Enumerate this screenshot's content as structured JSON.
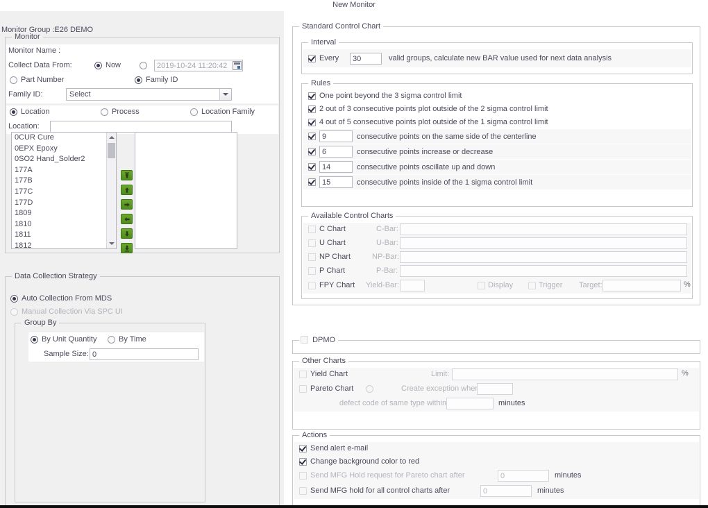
{
  "window": {
    "title": "New Monitor"
  },
  "left": {
    "monitor_group_label": "Monitor Group :E26 DEMO",
    "monitor_legend": "Monitor",
    "monitor_name_label": "Monitor Name :",
    "collect_data_from_label": "Collect Data From:",
    "now_label": "Now",
    "datetime_value": "2019-10-24 11:20:42",
    "calendar_icon": "calendar-icon",
    "part_number_label": "Part Number",
    "family_id_radio_label": "Family ID",
    "family_id_label": "Family ID:",
    "family_id_value": "Select",
    "location_radio_label": "Location",
    "process_radio_label": "Process",
    "location_family_radio_label": "Location Family",
    "location_label": "Location:",
    "location_value": "",
    "available_items": [
      "0CUR Cure",
      "0EPX Epoxy",
      "0SO2 Hand_Solder2",
      "177A",
      "177B",
      "177C",
      "177D",
      "1809",
      "1810",
      "1811",
      "1812"
    ],
    "selected_items": [],
    "transfer_buttons": [
      "move-all-up-button",
      "move-up-button",
      "move-right-button",
      "move-left-button",
      "move-down-button",
      "move-all-down-button"
    ],
    "strategy_legend": "Data Collection Strategy",
    "auto_collection_label": "Auto Collection From MDS",
    "manual_collection_label": "Manual Collection Via SPC UI",
    "group_by_legend": "Group By",
    "by_unit_quantity_label": "By Unit Quantity",
    "by_time_label": "By Time",
    "sample_size_label": "Sample Size:",
    "sample_size_value": "0"
  },
  "right": {
    "scc_legend": "Standard Control Chart",
    "interval": {
      "legend": "Interval",
      "every_label": "Every",
      "every_value": "30",
      "description": "valid groups, calculate new BAR value used for next data analysis"
    },
    "rules": {
      "legend": "Rules",
      "simple": [
        "One point beyond the 3 sigma control limit",
        "2 out of 3 consecutive points plot outside of the 2 sigma control limit",
        "4 out of 5 consecutive points plot outside of the 1 sigma control limit"
      ],
      "numeric": [
        {
          "value": "9",
          "text": "consecutive points on the same side of the centerline"
        },
        {
          "value": "6",
          "text": "consecutive points increase or decrease"
        },
        {
          "value": "14",
          "text": "consecutive points oscillate up and down"
        },
        {
          "value": "15",
          "text": "consecutive points inside of the 1 sigma control limit"
        }
      ]
    },
    "available_charts": {
      "legend": "Available Control Charts",
      "rows": [
        {
          "name": "C Chart",
          "bar_label": "C-Bar:",
          "value": ""
        },
        {
          "name": "U Chart",
          "bar_label": "U-Bar:",
          "value": ""
        },
        {
          "name": "NP Chart",
          "bar_label": "NP-Bar:",
          "value": ""
        },
        {
          "name": "P Chart",
          "bar_label": "P-Bar:",
          "value": ""
        }
      ],
      "fpy": {
        "name": "FPY Chart",
        "bar_label": "Yield-Bar:",
        "bar_value": "",
        "display_label": "Display",
        "trigger_label": "Trigger",
        "target_label": "Target:",
        "target_value": "",
        "percent_symbol": "%"
      }
    },
    "dpmo": {
      "legend": "DPMO"
    },
    "other_charts": {
      "legend": "Other Charts",
      "yield_label": "Yield Chart",
      "limit_label": "Limit:",
      "limit_value": "",
      "percent_symbol": "%",
      "pareto_label": "Pareto Chart",
      "exception_label": "Create exception when",
      "exception_value": "",
      "defect_label": "defect code of same type within",
      "defect_value": "",
      "minutes_label": "minutes"
    },
    "actions": {
      "legend": "Actions",
      "send_alert_label": "Send alert e-mail",
      "change_bg_label": "Change background color to red",
      "mfg_hold_pareto_label": "Send MFG Hold request for Pareto chart after",
      "mfg_hold_pareto_value": "0",
      "mfg_hold_pareto_minutes": "minutes",
      "mfg_hold_all_label": "Send MFG hold for all control charts after",
      "mfg_hold_all_value": "0",
      "mfg_hold_all_minutes": "minutes"
    }
  }
}
